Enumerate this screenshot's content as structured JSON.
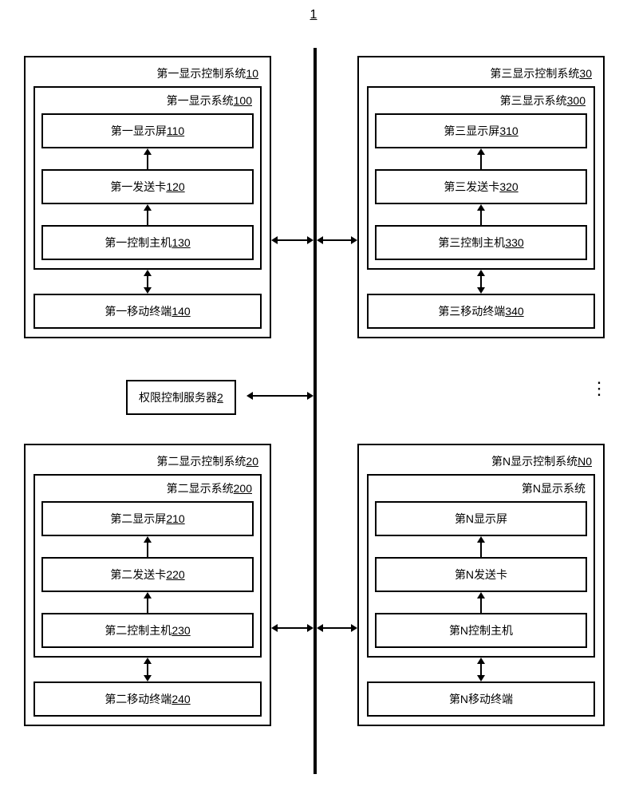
{
  "figure_label": "1",
  "server": {
    "label": "权限控制服务器",
    "ref": "2"
  },
  "ellipsis": "⋮",
  "systems": {
    "s1": {
      "outer_title": "第一显示控制系统",
      "outer_ref": "10",
      "inner_title": "第一显示系统",
      "inner_ref": "100",
      "screen": {
        "label": "第一显示屏",
        "ref": "110"
      },
      "sender": {
        "label": "第一发送卡",
        "ref": "120"
      },
      "host": {
        "label": "第一控制主机",
        "ref": "130"
      },
      "terminal": {
        "label": "第一移动终端",
        "ref": "140"
      }
    },
    "s2": {
      "outer_title": "第二显示控制系统",
      "outer_ref": "20",
      "inner_title": "第二显示系统",
      "inner_ref": "200",
      "screen": {
        "label": "第二显示屏",
        "ref": "210"
      },
      "sender": {
        "label": "第二发送卡",
        "ref": "220"
      },
      "host": {
        "label": "第二控制主机",
        "ref": "230"
      },
      "terminal": {
        "label": "第二移动终端",
        "ref": "240"
      }
    },
    "s3": {
      "outer_title": "第三显示控制系统",
      "outer_ref": "30",
      "inner_title": "第三显示系统",
      "inner_ref": "300",
      "screen": {
        "label": "第三显示屏",
        "ref": "310"
      },
      "sender": {
        "label": "第三发送卡",
        "ref": "320"
      },
      "host": {
        "label": "第三控制主机",
        "ref": "330"
      },
      "terminal": {
        "label": "第三移动终端",
        "ref": "340"
      }
    },
    "sN": {
      "outer_title": "第N显示控制系统",
      "outer_ref": "N0",
      "inner_title": "第N显示系统",
      "inner_ref": "",
      "screen": {
        "label": "第N显示屏",
        "ref": ""
      },
      "sender": {
        "label": "第N发送卡",
        "ref": ""
      },
      "host": {
        "label": "第N控制主机",
        "ref": ""
      },
      "terminal": {
        "label": "第N移动终端",
        "ref": ""
      }
    }
  }
}
